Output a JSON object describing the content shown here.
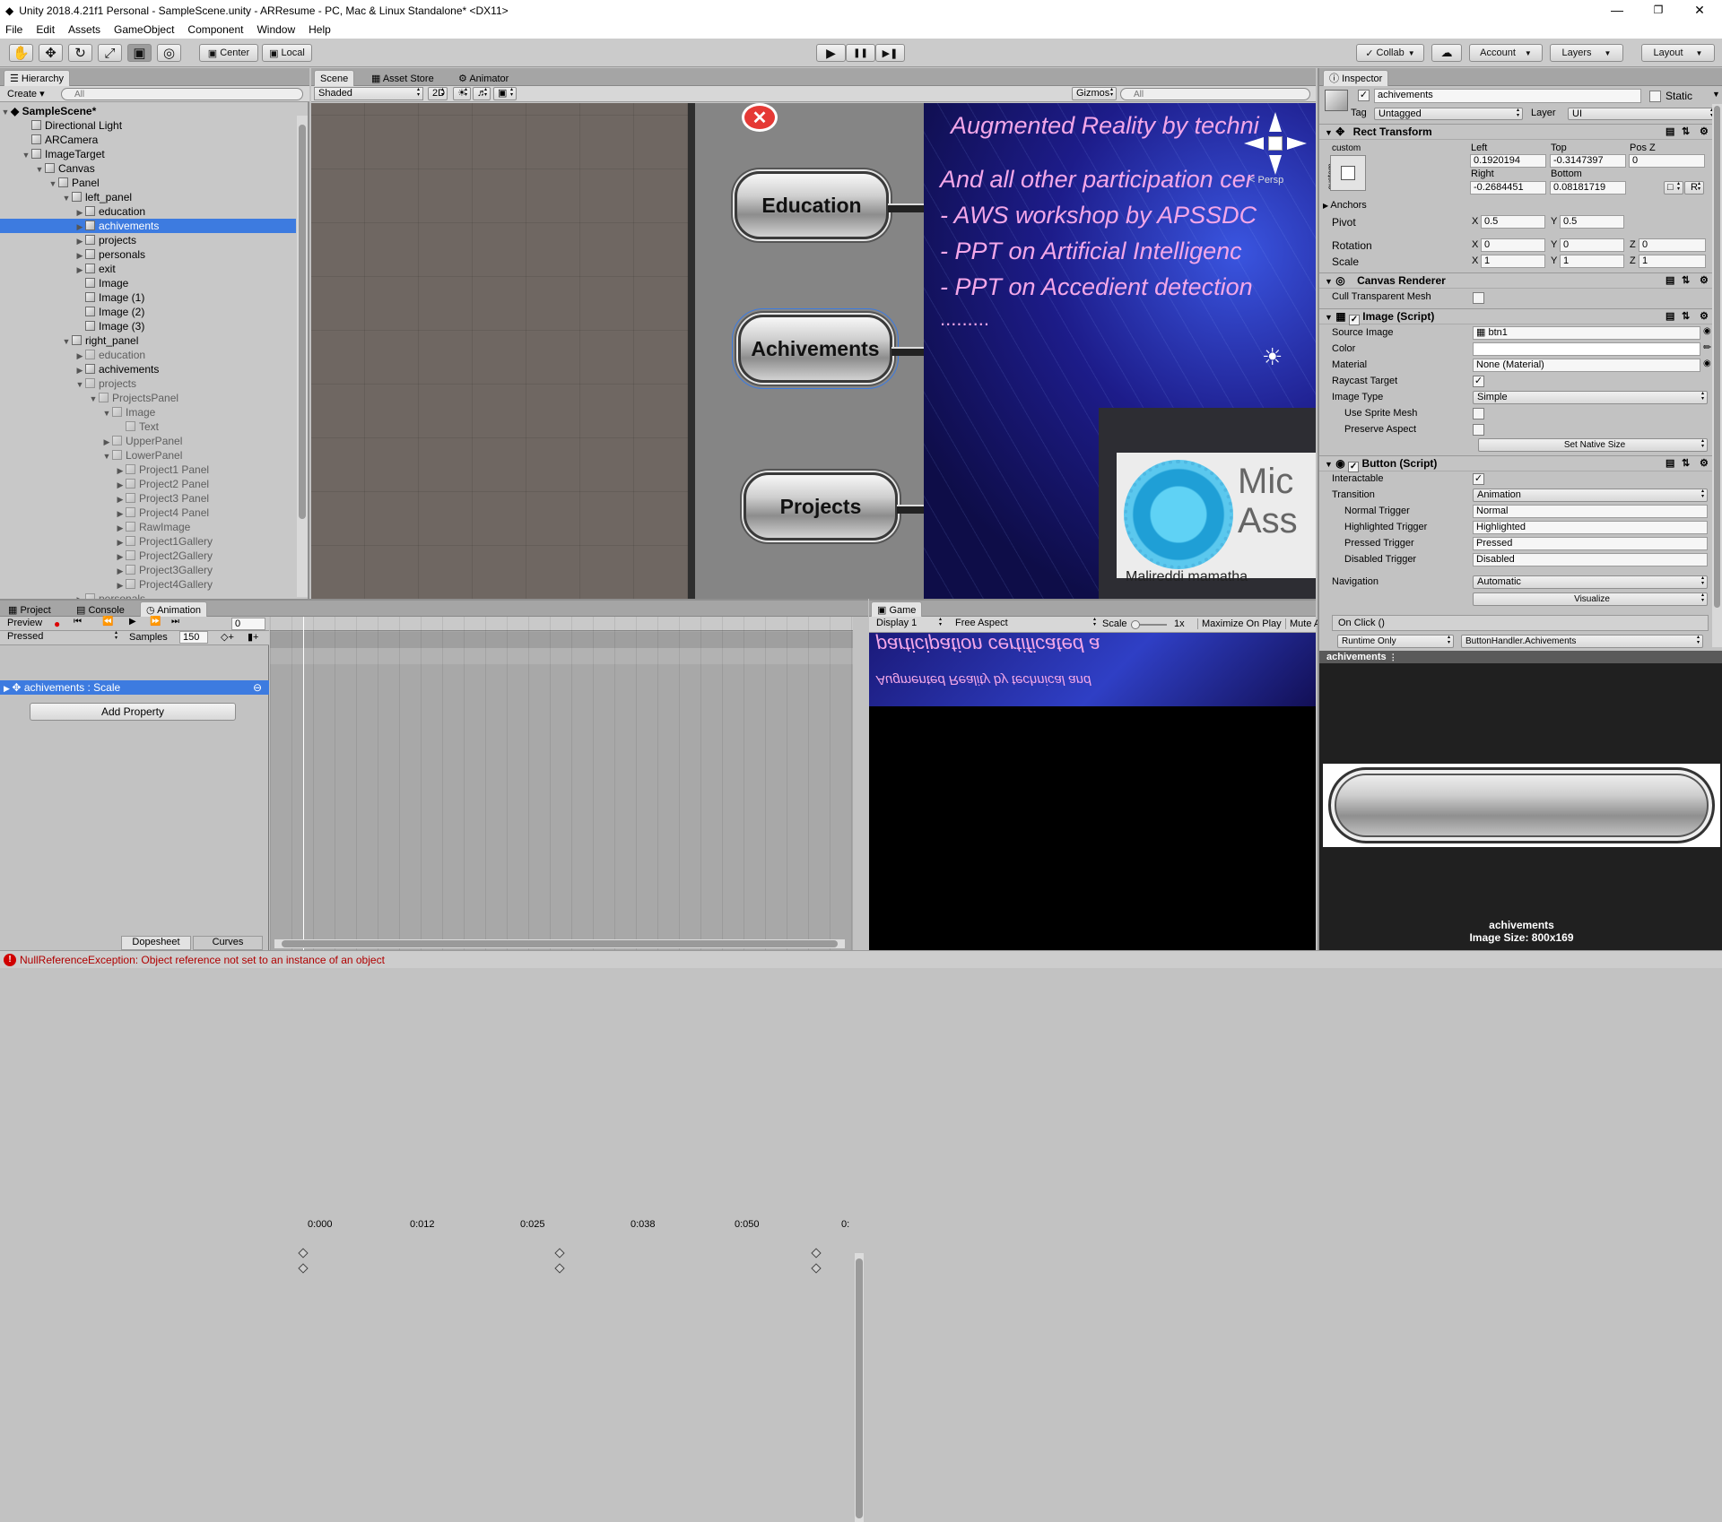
{
  "window": {
    "title": "Unity 2018.4.21f1 Personal - SampleScene.unity - ARResume - PC, Mac & Linux Standalone* <DX11>",
    "min": "—",
    "max": "❐",
    "close": "✕"
  },
  "menu": [
    "File",
    "Edit",
    "Assets",
    "GameObject",
    "Component",
    "Window",
    "Help"
  ],
  "toolbar": {
    "tools": [
      "✋",
      "✥",
      "↻",
      "⤢",
      "▣",
      "◎"
    ],
    "pivot": "Center",
    "space": "Local",
    "play": "▶",
    "pause": "❚❚",
    "step": "▶❚",
    "collab": "Collab",
    "cloud": "☁",
    "account": "Account",
    "layers": "Layers",
    "layout": "Layout"
  },
  "hierarchy": {
    "tab": "Hierarchy",
    "create": "Create",
    "search_placeholder": "All",
    "scene": "SampleScene*",
    "items": [
      {
        "label": "Directional Light",
        "indent": 1,
        "tri": ""
      },
      {
        "label": "ARCamera",
        "indent": 1,
        "tri": ""
      },
      {
        "label": "ImageTarget",
        "indent": 1,
        "tri": "▼"
      },
      {
        "label": "Canvas",
        "indent": 2,
        "tri": "▼"
      },
      {
        "label": "Panel",
        "indent": 3,
        "tri": "▼"
      },
      {
        "label": "left_panel",
        "indent": 4,
        "tri": "▼"
      },
      {
        "label": "education",
        "indent": 5,
        "tri": "▶"
      },
      {
        "label": "achivements",
        "indent": 5,
        "tri": "▶",
        "selected": true
      },
      {
        "label": "projects",
        "indent": 5,
        "tri": "▶"
      },
      {
        "label": "personals",
        "indent": 5,
        "tri": "▶"
      },
      {
        "label": "exit",
        "indent": 5,
        "tri": "▶"
      },
      {
        "label": "Image",
        "indent": 5,
        "tri": ""
      },
      {
        "label": "Image (1)",
        "indent": 5,
        "tri": ""
      },
      {
        "label": "Image (2)",
        "indent": 5,
        "tri": ""
      },
      {
        "label": "Image (3)",
        "indent": 5,
        "tri": ""
      },
      {
        "label": "right_panel",
        "indent": 4,
        "tri": "▼"
      },
      {
        "label": "education",
        "indent": 5,
        "tri": "▶",
        "grey": true
      },
      {
        "label": "achivements",
        "indent": 5,
        "tri": "▶"
      },
      {
        "label": "projects",
        "indent": 5,
        "tri": "▼",
        "grey": true
      },
      {
        "label": "ProjectsPanel",
        "indent": 6,
        "tri": "▼",
        "grey": true
      },
      {
        "label": "Image",
        "indent": 7,
        "tri": "▼",
        "grey": true
      },
      {
        "label": "Text",
        "indent": 8,
        "tri": "",
        "grey": true
      },
      {
        "label": "UpperPanel",
        "indent": 7,
        "tri": "▶",
        "grey": true
      },
      {
        "label": "LowerPanel",
        "indent": 7,
        "tri": "▼",
        "grey": true
      },
      {
        "label": "Project1 Panel",
        "indent": 8,
        "tri": "▶",
        "grey": true
      },
      {
        "label": "Project2 Panel",
        "indent": 8,
        "tri": "▶",
        "grey": true
      },
      {
        "label": "Project3 Panel",
        "indent": 8,
        "tri": "▶",
        "grey": true
      },
      {
        "label": "Project4 Panel",
        "indent": 8,
        "tri": "▶",
        "grey": true
      },
      {
        "label": "RawImage",
        "indent": 8,
        "tri": "▶",
        "grey": true
      },
      {
        "label": "Project1Gallery",
        "indent": 8,
        "tri": "▶",
        "grey": true
      },
      {
        "label": "Project2Gallery",
        "indent": 8,
        "tri": "▶",
        "grey": true
      },
      {
        "label": "Project3Gallery",
        "indent": 8,
        "tri": "▶",
        "grey": true
      },
      {
        "label": "Project4Gallery",
        "indent": 8,
        "tri": "▶",
        "grey": true
      },
      {
        "label": "personals",
        "indent": 5,
        "tri": "▶",
        "grey": true
      }
    ]
  },
  "scene": {
    "tabs": [
      "Scene",
      "Asset Store",
      "Animator"
    ],
    "shading": "Shaded",
    "mode2d": "2D",
    "gizmos": "Gizmos",
    "search_placeholder": "All",
    "persp": "< Persp",
    "buttons": [
      "Education",
      "Achivements",
      "Projects"
    ],
    "cert_lines": [
      "Augmented Reality by techni",
      "And all other participation cer",
      "- AWS workshop by APSSDC",
      "- PPT on Artificial Intelligenc",
      "- PPT on Accedient detection",
      "........."
    ],
    "ms_text": "Mic\nAss",
    "name": "Malireddi mamatha",
    "close_x": "✕"
  },
  "bottom": {
    "tabs": [
      "Project",
      "Console",
      "Animation"
    ],
    "preview": "Preview",
    "clip": "Pressed",
    "samples_label": "Samples",
    "samples": "150",
    "frame": "0",
    "track": "achivements : Scale",
    "add_property": "Add Property",
    "dopesheet": "Dopesheet",
    "curves": "Curves",
    "ticks": [
      "0:000",
      "0:012",
      "0:025",
      "0:038",
      "0:050",
      "0:"
    ]
  },
  "game": {
    "tab": "Game",
    "display": "Display 1",
    "aspect": "Free Aspect",
    "scale_label": "Scale",
    "scale_val": "1x",
    "maximize": "Maximize On Play",
    "mute": "Mute A",
    "mirrored1": "participation certificated a",
    "mirrored2": "Augmented Reality by technical and"
  },
  "inspector": {
    "tab": "Inspector",
    "name": "achivements",
    "static": "Static",
    "tag_label": "Tag",
    "tag": "Untagged",
    "layer_label": "Layer",
    "layer": "UI",
    "rect": {
      "title": "Rect Transform",
      "anchor_preset": "custom",
      "anchor_side": "custom",
      "left_label": "Left",
      "top_label": "Top",
      "posz_label": "Pos Z",
      "left": "0.1920194",
      "top": "-0.3147397",
      "posz": "0",
      "right_label": "Right",
      "bottom_label": "Bottom",
      "right": "-0.2684451",
      "bottom": "0.08181719",
      "r_btn": "R",
      "anchors": "Anchors",
      "pivot": "Pivot",
      "pivot_x": "0.5",
      "pivot_y": "0.5",
      "rotation": "Rotation",
      "rot_x": "0",
      "rot_y": "0",
      "rot_z": "0",
      "scale": "Scale",
      "sc_x": "1",
      "sc_y": "1",
      "sc_z": "1"
    },
    "canvas_renderer": {
      "title": "Canvas Renderer",
      "cull": "Cull Transparent Mesh"
    },
    "image": {
      "title": "Image (Script)",
      "source_label": "Source Image",
      "source": "btn1",
      "color_label": "Color",
      "material_label": "Material",
      "material": "None (Material)",
      "raycast": "Raycast Target",
      "type_label": "Image Type",
      "type": "Simple",
      "sprite_mesh": "Use Sprite Mesh",
      "preserve": "Preserve Aspect",
      "native": "Set Native Size"
    },
    "button": {
      "title": "Button (Script)",
      "interactable": "Interactable",
      "transition_label": "Transition",
      "transition": "Animation",
      "normal_label": "Normal Trigger",
      "normal": "Normal",
      "highlighted_label": "Highlighted Trigger",
      "highlighted": "Highlighted",
      "pressed_label": "Pressed Trigger",
      "pressed": "Pressed",
      "disabled_label": "Disabled Trigger",
      "disabled": "Disabled",
      "nav_label": "Navigation",
      "nav": "Automatic",
      "visualize": "Visualize",
      "onclick": "On Click ()",
      "runtime": "Runtime Only",
      "handler": "ButtonHandler.Achivements"
    },
    "preview": {
      "header": "achivements",
      "caption": "achivements",
      "size": "Image Size: 800x169"
    }
  },
  "status": {
    "icon": "!",
    "message": "NullReferenceException: Object reference not set to an instance of an object"
  },
  "colors": {
    "selection": "#3d7be0",
    "timeline_bg": "#a8a8a8",
    "scene_bg": "#6d6560",
    "error": "#d00000"
  }
}
